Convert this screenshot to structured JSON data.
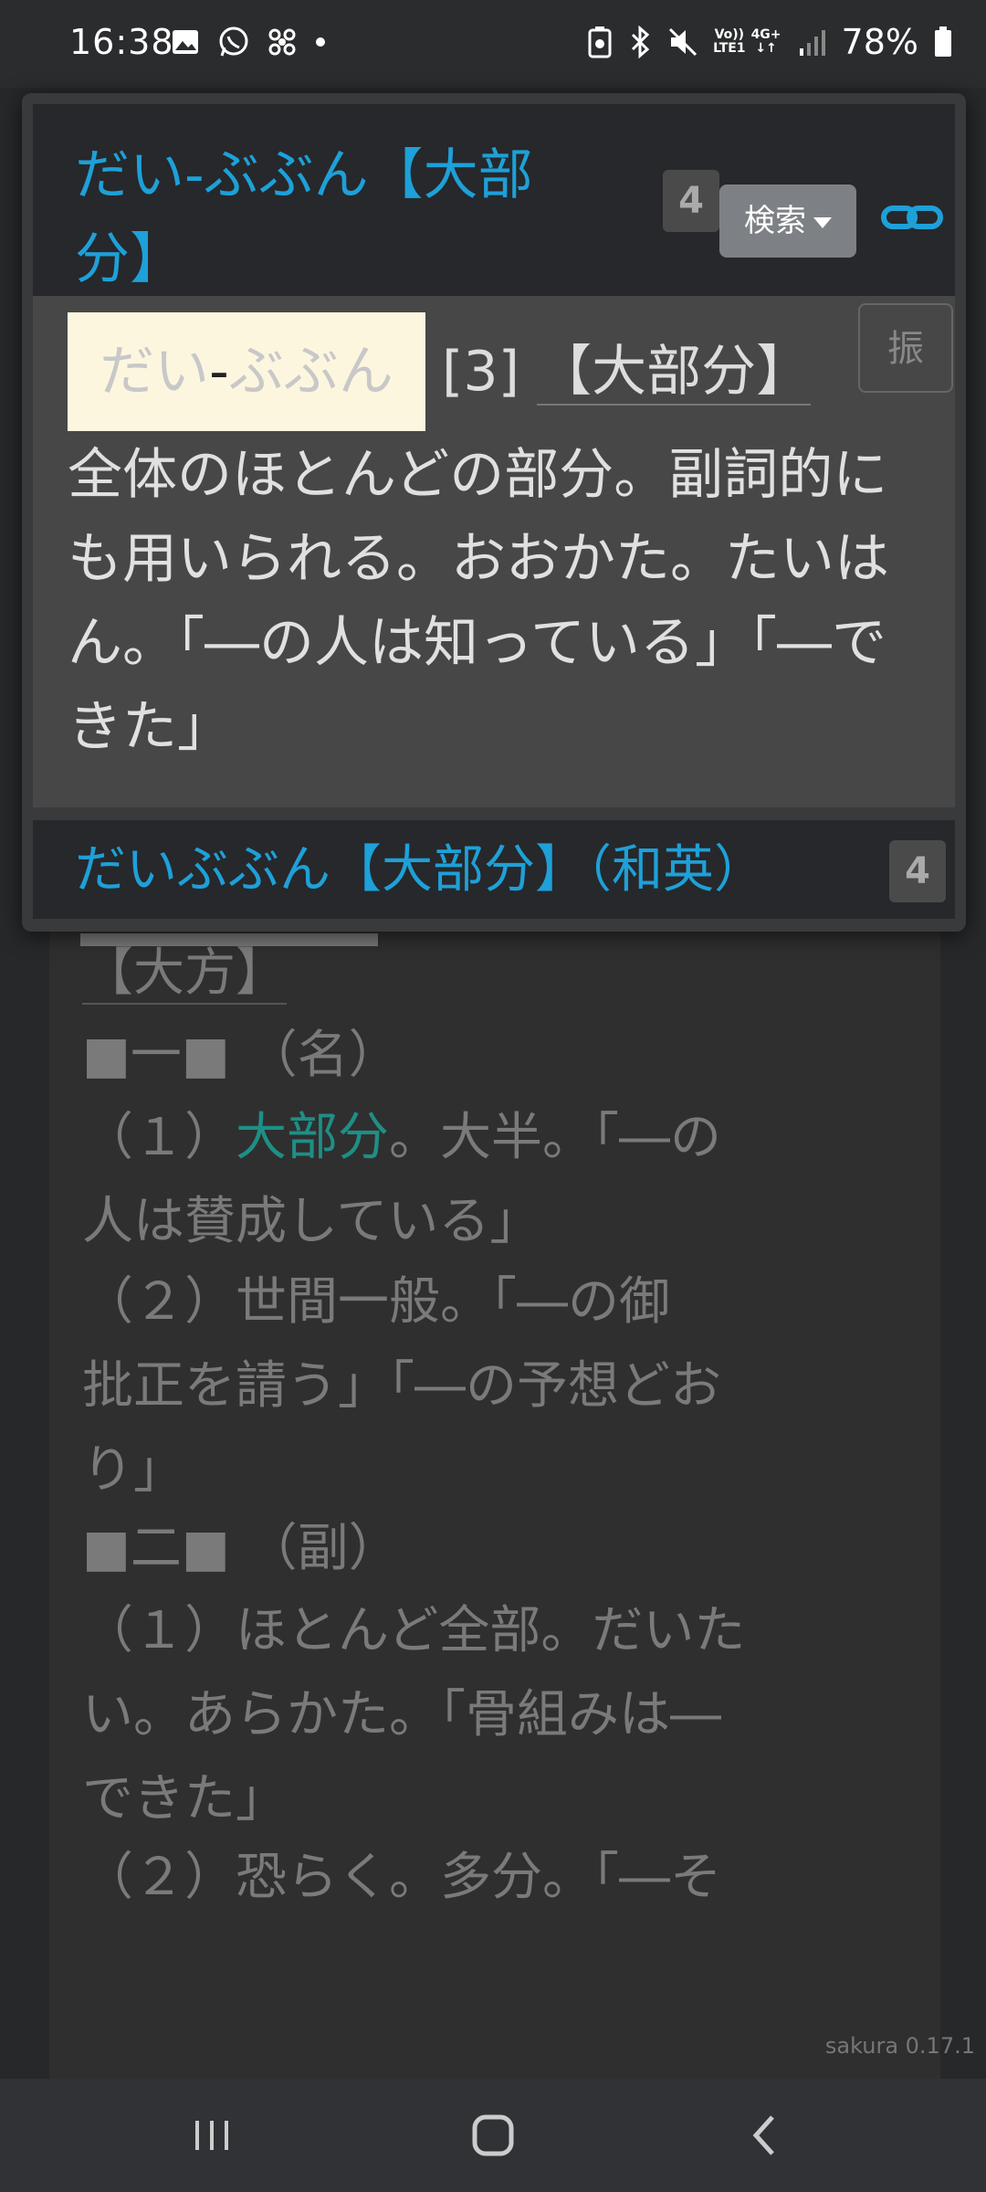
{
  "status_bar": {
    "time": "16:38",
    "battery": "78%",
    "network_top": "Vo))",
    "network_bottom": "LTE1",
    "network_gen": "4G+"
  },
  "popup": {
    "entry_title": "だい‐ぶぶん【大部分】",
    "entry_count": "4",
    "search_button": "検索",
    "furigana_button": "振",
    "headword_kana": {
      "pre": "だい",
      "dash": "‐",
      "post": "ぶぶん"
    },
    "accent": "[3]",
    "headword_kanji": "【大部分】",
    "definition": "全体のほとんどの部分。副詞的にも用いられる。おおかた。たいはん。「―の人は知っている」「―できた」",
    "second_entry_title": "だいぶぶん【大部分】（和英）",
    "second_entry_count": "4"
  },
  "background_article": {
    "lines": [
      "【大方】",
      "■一■ （名）",
      "（１）大部分。大半。「―の人は賛成している」",
      "（２）世間一般。「―の御批正を請う」「―の予想どおり」",
      "■二■ （副）",
      "（１）ほとんど全部。だいたい。あらかた。「骨組みは―できた」",
      "（２）恐らく。多分。「―そ"
    ],
    "link_word": "大部分"
  },
  "version": "sakura 0.17.1",
  "colors": {
    "accent_blue": "#1ea0d8",
    "link_teal": "#1e8f86",
    "highlight": "#fdf6df"
  }
}
